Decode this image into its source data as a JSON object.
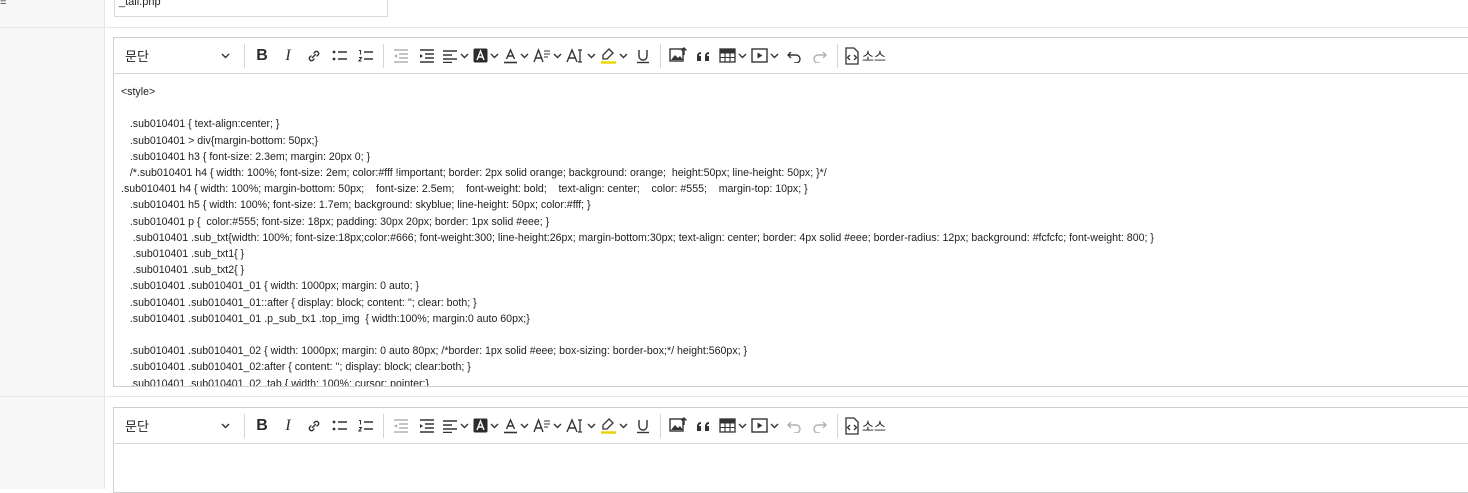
{
  "top": {
    "left_marker": "=",
    "filename_value": "_tail.php"
  },
  "editor1": {
    "paragraph_label": "문단",
    "source_label": "소스",
    "code_lines": [
      "<style>",
      "",
      "   .sub010401 { text-align:center; }",
      "   .sub010401 > div{margin-bottom: 50px;}",
      "   .sub010401 h3 { font-size: 2.3em; margin: 20px 0; }",
      "   /*.sub010401 h4 { width: 100%; font-size: 2em; color:#fff !important; border: 2px solid orange; background: orange;  height:50px; line-height: 50px; }*/",
      ".sub010401 h4 { width: 100%; margin-bottom: 50px;    font-size: 2.5em;    font-weight: bold;    text-align: center;    color: #555;    margin-top: 10px; }",
      "   .sub010401 h5 { width: 100%; font-size: 1.7em; background: skyblue; line-height: 50px; color:#fff; }",
      "   .sub010401 p {  color:#555; font-size: 18px; padding: 30px 20px; border: 1px solid #eee; }",
      "    .sub010401 .sub_txt{width: 100%; font-size:18px;color:#666; font-weight:300; line-height:26px; margin-bottom:30px; text-align: center; border: 4px solid #eee; border-radius: 12px; background: #fcfcfc; font-weight: 800; }",
      "    .sub010401 .sub_txt1{ }",
      "    .sub010401 .sub_txt2{ }",
      "   .sub010401 .sub010401_01 { width: 1000px; margin: 0 auto; }",
      "   .sub010401 .sub010401_01::after { display: block; content: ''; clear: both; }",
      "   .sub010401 .sub010401_01 .p_sub_tx1 .top_img  { width:100%; margin:0 auto 60px;}",
      "",
      "   .sub010401 .sub010401_02 { width: 1000px; margin: 0 auto 80px; /*border: 1px solid #eee; box-sizing: border-box;*/ height:560px; }",
      "   .sub010401 .sub010401_02:after { content: ''; display: block; clear:both; }",
      "   .sub010401 .sub010401_02 .tab { width: 100%; cursor: pointer;}"
    ]
  },
  "editor2": {
    "paragraph_label": "문단",
    "source_label": "소스"
  },
  "icons": {
    "bold": "bold-icon",
    "italic": "italic-icon",
    "link": "link-icon",
    "bullet_list": "bullet-list-icon",
    "numbered_list": "numbered-list-icon",
    "outdent": "outdent-icon",
    "indent": "indent-icon",
    "align": "align-icon",
    "font_bg_color": "font-background-color-icon",
    "font_color": "font-color-icon",
    "font_size": "font-size-icon",
    "font_family": "font-family-icon",
    "highlight": "highlight-icon",
    "underline": "underline-icon",
    "image": "image-upload-icon",
    "quote": "blockquote-icon",
    "table": "table-icon",
    "media": "media-embed-icon",
    "undo": "undo-icon",
    "redo": "redo-icon",
    "source": "source-code-icon"
  }
}
